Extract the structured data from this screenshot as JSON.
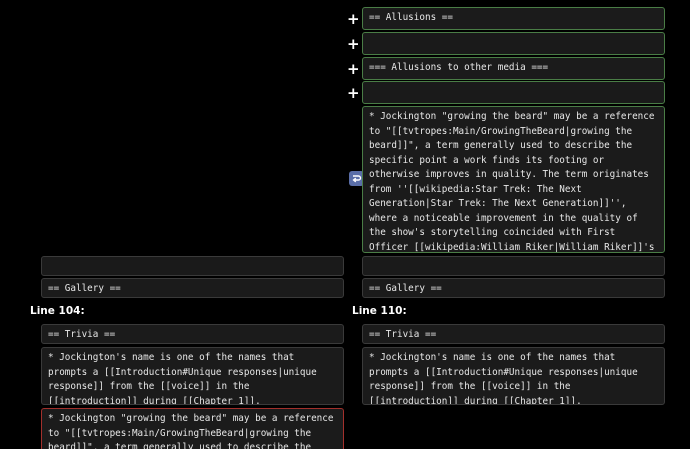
{
  "right": {
    "allusions_header": "== Allusions ==",
    "empty_1": "",
    "allusions_other_media": "=== Allusions to other media ===",
    "empty_2": "",
    "beard_paragraph": "* Jockington \"growing the beard\" may be a reference to \"[[tvtropes:Main/GrowingTheBeard|growing the beard]]\", a term generally used to describe the specific point a work finds its footing or otherwise improves in quality. The term originates from ''[[wikipedia:Star Trek: The Next Generation|Star Trek: The Next Generation]]'', where a noticeable improvement in the quality of the show's storytelling coincided with First Officer [[wikipedia:William Riker|William Riker]]'s actor, [[wikipedia:Jonathan Frakes|Jonathan Frakes]], growing a beard.",
    "empty_3": "",
    "gallery": "== Gallery ==",
    "line_label": "Line 110:",
    "trivia": "== Trivia ==",
    "trivia_paragraph": "* Jockington's name is one of the names that prompts a [[Introduction#Unique responses|unique response]] from the [[voice]] in the [[introduction]] during [[Chapter 1]]."
  },
  "left": {
    "empty_1": "",
    "gallery": "== Gallery ==",
    "line_label": "Line 104:",
    "trivia": "== Trivia ==",
    "trivia_paragraph": "* Jockington's name is one of the names that prompts a [[Introduction#Unique responses|unique response]] from the [[voice]] in the [[introduction]] during [[Chapter 1]].",
    "beard_paragraph": "* Jockington \"growing the beard\" may be a reference to \"[[tvtropes:Main/GrowingTheBeard|growing the beard]]\", a term generally used to describe the specific point a work"
  },
  "icons": {
    "plus": "+",
    "wrap": "wrap-arrow-icon"
  },
  "colors": {
    "added_border": "#4a7d46",
    "removed_border": "#a3302c",
    "wrap_icon_bg": "#5a6ea8"
  }
}
